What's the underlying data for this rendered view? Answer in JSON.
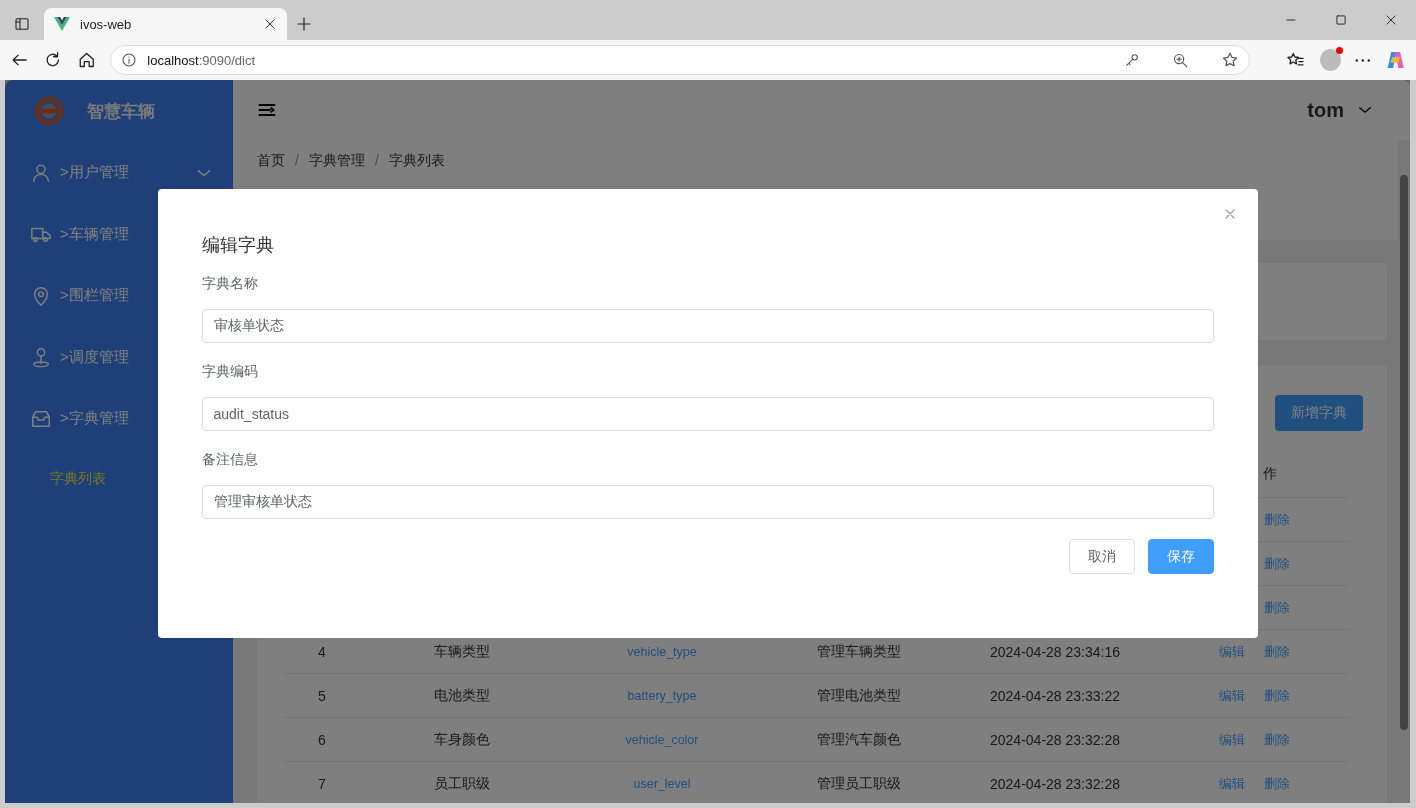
{
  "browser": {
    "tab_title": "ivos-web",
    "url_host": "localhost",
    "url_rest": ":9090/dict"
  },
  "sidebar": {
    "brand": "智慧车辆",
    "items": [
      {
        "label": ">用户管理",
        "arrow": true
      },
      {
        "label": ">车辆管理",
        "arrow": false
      },
      {
        "label": ">围栏管理",
        "arrow": false
      },
      {
        "label": ">调度管理",
        "arrow": false
      },
      {
        "label": ">字典管理",
        "arrow": false,
        "children": [
          {
            "label": "字典列表",
            "selected": true
          }
        ]
      }
    ]
  },
  "header": {
    "user": "tom"
  },
  "breadcrumb": {
    "separator": "/",
    "items": [
      "首页",
      "字典管理",
      "字典列表"
    ]
  },
  "add_button": "新增字典",
  "table": {
    "last_header": "作",
    "rows": [
      {
        "delete": "删除"
      },
      {
        "delete": "删除"
      },
      {
        "delete": "删除"
      },
      {
        "index": "4",
        "name": "车辆类型",
        "code": "vehicle_type",
        "remark": "管理车辆类型",
        "created": "2024-04-28 23:34:16",
        "edit": "编辑",
        "delete": "删除"
      },
      {
        "index": "5",
        "name": "电池类型",
        "code": "battery_type",
        "remark": "管理电池类型",
        "created": "2024-04-28 23:33:22",
        "edit": "编辑",
        "delete": "删除"
      },
      {
        "index": "6",
        "name": "车身颜色",
        "code": "vehicle_color",
        "remark": "管理汽车颜色",
        "created": "2024-04-28 23:32:28",
        "edit": "编辑",
        "delete": "删除"
      },
      {
        "index": "7",
        "name": "员工职级",
        "code": "user_level",
        "remark": "管理员工职级",
        "created": "2024-04-28 23:32:28",
        "edit": "编辑",
        "delete": "删除"
      }
    ]
  },
  "dialog": {
    "title": "编辑字典",
    "fields": [
      {
        "label": "字典名称",
        "value": "审核单状态"
      },
      {
        "label": "字典编码",
        "value": "audit_status"
      },
      {
        "label": "备注信息",
        "value": "管理审核单状态"
      }
    ],
    "buttons": [
      {
        "label": "取消",
        "kind": "default"
      },
      {
        "label": "保存",
        "kind": "primary"
      }
    ]
  }
}
